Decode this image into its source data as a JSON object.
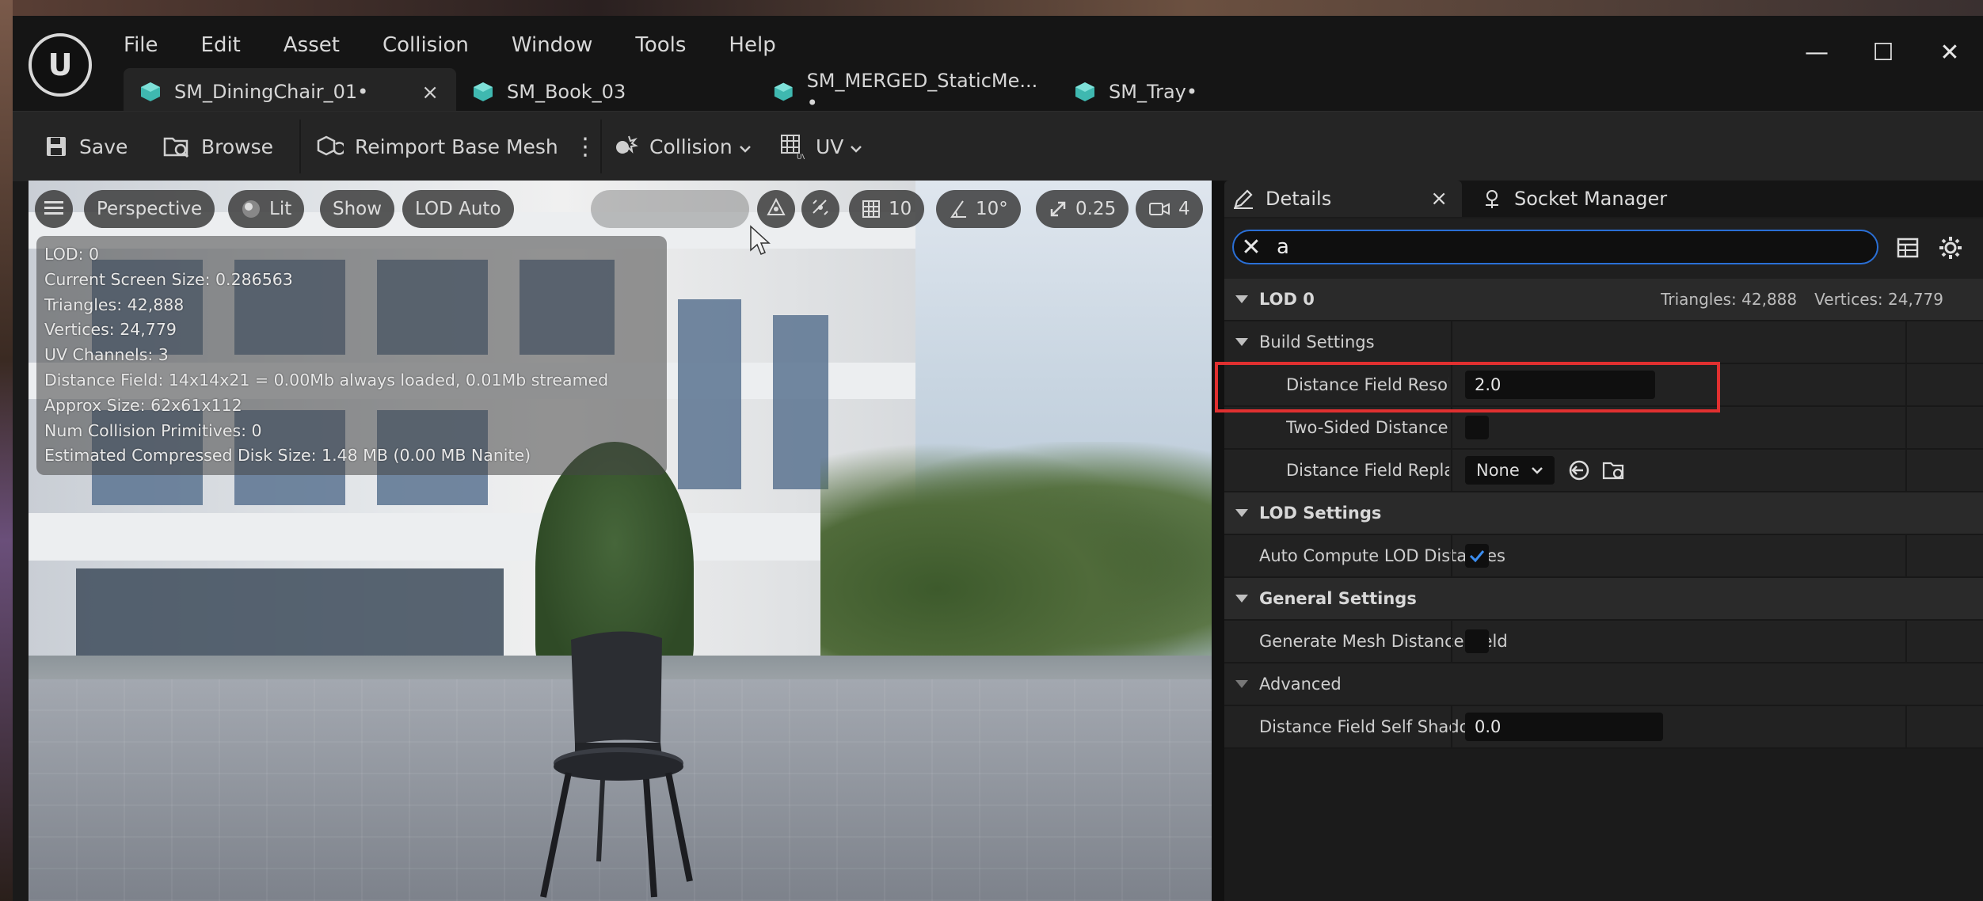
{
  "menu": [
    "File",
    "Edit",
    "Asset",
    "Collision",
    "Window",
    "Tools",
    "Help"
  ],
  "tabs": [
    {
      "label": "SM_DiningChair_01•",
      "close": "×"
    },
    {
      "label": "SM_Book_03"
    },
    {
      "label": "SM_MERGED_StaticMe... •"
    },
    {
      "label": "SM_Tray•"
    }
  ],
  "window_controls": {
    "minimize": "—",
    "maximize": "☐",
    "close": "✕"
  },
  "toolbar": {
    "save": "Save",
    "browse": "Browse",
    "reimport": "Reimport Base Mesh",
    "kebab": "⋮",
    "collision": "Collision",
    "uv": "UV"
  },
  "viewport": {
    "perspective": "Perspective",
    "lit": "Lit",
    "show": "Show",
    "lod": "LOD Auto",
    "grid_snap": "10",
    "rot_snap": "10°",
    "scale_snap": "0.25",
    "camera_speed": "4",
    "stats": [
      "LOD: 0",
      "Current Screen Size: 0.286563",
      "Triangles: 42,888",
      "Vertices: 24,779",
      "UV Channels: 3",
      "Distance Field: 14x14x21 = 0.00Mb always loaded, 0.01Mb streamed",
      "Approx Size: 62x61x112",
      "Num Collision Primitives: 0",
      "Estimated Compressed Disk Size: 1.48 MB (0.00 MB Nanite)"
    ]
  },
  "details": {
    "tab_details": "Details",
    "tab_close": "×",
    "tab_socket": "Socket Manager",
    "search_value": "a",
    "lod0": {
      "label": "LOD 0",
      "triangles": "Triangles: 42,888",
      "vertices": "Vertices: 24,779"
    },
    "build_settings": "Build Settings",
    "df_resolution": {
      "label": "Distance Field Resolution Sc",
      "value": "2.0"
    },
    "two_sided": {
      "label": "Two-Sided Distance Field Ge"
    },
    "df_replacement": {
      "label": "Distance Field Replacement",
      "value": "None"
    },
    "lod_settings": "LOD Settings",
    "auto_compute": {
      "label": "Auto Compute LOD Distances",
      "checked": true
    },
    "general_settings": "General Settings",
    "gen_mesh_df": {
      "label": "Generate Mesh Distance Field",
      "checked": false
    },
    "advanced": "Advanced",
    "self_shadow": {
      "label": "Distance Field Self Shadow Bias",
      "value": "0.0"
    }
  },
  "colors": {
    "accent": "#2a6fd6",
    "highlight": "#e03030",
    "tab_icon": "#3fb8b0"
  }
}
